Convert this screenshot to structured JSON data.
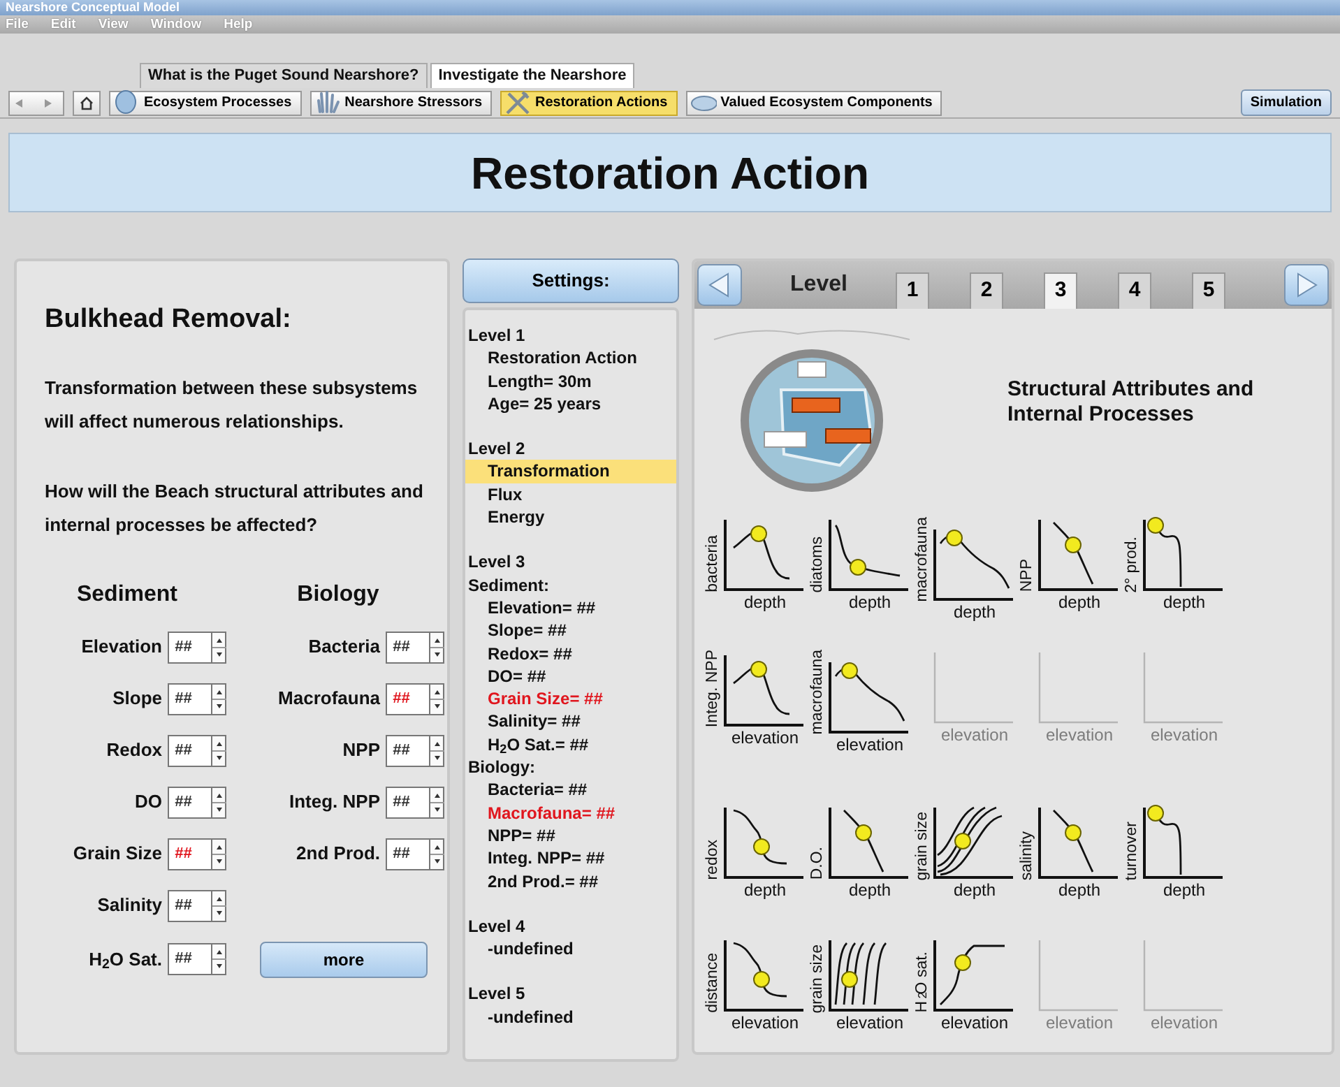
{
  "window": {
    "title": "Nearshore Conceptual Model"
  },
  "menu": [
    "File",
    "Edit",
    "View",
    "Window",
    "Help"
  ],
  "main_tabs": [
    {
      "label": "What is the Puget Sound Nearshore?",
      "selected": false
    },
    {
      "label": "Investigate the Nearshore",
      "selected": true
    }
  ],
  "toolbar": {
    "buttons": [
      {
        "label": "Ecosystem Processes",
        "selected": false
      },
      {
        "label": "Nearshore Stressors",
        "selected": false
      },
      {
        "label": "Restoration Actions",
        "selected": true
      },
      {
        "label": "Valued Ecosystem Components",
        "selected": false
      }
    ],
    "simulation_button": "Simulation"
  },
  "banner": "Restoration Action",
  "action": {
    "title": "Bulkhead Removal:",
    "description": "Transformation between these subsystems will affect numerous relationships.",
    "question": "How will the Beach structural attributes and internal processes be affected?",
    "columns": [
      {
        "heading": "Sediment",
        "fields": [
          {
            "label": "Elevation",
            "value": "##",
            "changed": false
          },
          {
            "label": "Slope",
            "value": "##",
            "changed": false
          },
          {
            "label": "Redox",
            "value": "##",
            "changed": false
          },
          {
            "label": "DO",
            "value": "##",
            "changed": false
          },
          {
            "label": "Grain Size",
            "value": "##",
            "changed": true
          },
          {
            "label": "Salinity",
            "value": "##",
            "changed": false
          },
          {
            "label": "H$_{2}$O Sat.",
            "value": "##",
            "changed": false
          }
        ]
      },
      {
        "heading": "Biology",
        "fields": [
          {
            "label": "Bacteria",
            "value": "##",
            "changed": false
          },
          {
            "label": "Macrofauna",
            "value": "##",
            "changed": true
          },
          {
            "label": "NPP",
            "value": "##",
            "changed": false
          },
          {
            "label": "Integ. NPP",
            "value": "##",
            "changed": false
          },
          {
            "label": "2nd Prod.",
            "value": "##",
            "changed": false
          }
        ]
      }
    ],
    "more_button": "more"
  },
  "settings": {
    "button": "Settings:",
    "groups": [
      {
        "title": "Level 1",
        "entries": [
          {
            "kind": "item",
            "text": "Restoration Action",
            "selected": false,
            "changed": false
          },
          {
            "kind": "item",
            "text": "Length= 30m",
            "selected": false,
            "changed": false
          },
          {
            "kind": "item",
            "text": "Age= 25 years",
            "selected": false,
            "changed": false
          }
        ]
      },
      {
        "title": "Level 2",
        "entries": [
          {
            "kind": "item",
            "text": "Transformation",
            "selected": true,
            "changed": false
          },
          {
            "kind": "item",
            "text": "Flux",
            "selected": false,
            "changed": false
          },
          {
            "kind": "item",
            "text": "Energy",
            "selected": false,
            "changed": false
          }
        ]
      },
      {
        "title": "Level 3",
        "entries": [
          {
            "kind": "subheading",
            "text": "Sediment:",
            "selected": false,
            "changed": false
          },
          {
            "kind": "item",
            "text": "Elevation= ##",
            "selected": false,
            "changed": false
          },
          {
            "kind": "item",
            "text": "Slope= ##",
            "selected": false,
            "changed": false
          },
          {
            "kind": "item",
            "text": "Redox= ##",
            "selected": false,
            "changed": false
          },
          {
            "kind": "item",
            "text": "DO= ##",
            "selected": false,
            "changed": false
          },
          {
            "kind": "item",
            "text": "Grain Size= ##",
            "selected": false,
            "changed": true
          },
          {
            "kind": "item",
            "text": "Salinity= ##",
            "selected": false,
            "changed": false
          },
          {
            "kind": "item",
            "text": "H$_{2}$O Sat.= ##",
            "selected": false,
            "changed": false
          },
          {
            "kind": "subheading",
            "text": "Biology:",
            "selected": false,
            "changed": false
          },
          {
            "kind": "item",
            "text": "Bacteria= ##",
            "selected": false,
            "changed": false
          },
          {
            "kind": "item",
            "text": "Macrofauna= ##",
            "selected": false,
            "changed": true
          },
          {
            "kind": "item",
            "text": "NPP= ##",
            "selected": false,
            "changed": false
          },
          {
            "kind": "item",
            "text": "Integ. NPP= ##",
            "selected": false,
            "changed": false
          },
          {
            "kind": "item",
            "text": "2nd Prod.= ##",
            "selected": false,
            "changed": false
          }
        ]
      },
      {
        "title": "Level 4",
        "entries": [
          {
            "kind": "item",
            "text": "-undefined",
            "selected": false,
            "changed": false
          }
        ]
      },
      {
        "title": "Level 5",
        "entries": [
          {
            "kind": "item",
            "text": "-undefined",
            "selected": false,
            "changed": false
          }
        ]
      }
    ]
  },
  "levels": {
    "label": "Level",
    "tabs": [
      {
        "label": "1",
        "selected": false
      },
      {
        "label": "2",
        "selected": false
      },
      {
        "label": "3",
        "selected": true
      },
      {
        "label": "4",
        "selected": false
      },
      {
        "label": "5",
        "selected": false
      }
    ],
    "heading": "Structural Attributes and Internal Processes",
    "plot_sections": [
      [
        [
          {
            "kind": "hump",
            "ylabel": "bacteria",
            "xlabel": "depth"
          },
          {
            "kind": "decay",
            "ylabel": "diatoms",
            "xlabel": "depth"
          },
          {
            "kind": "peak-decline",
            "ylabel": "macrofauna",
            "xlabel": "depth"
          },
          {
            "kind": "linear-decline",
            "ylabel": "NPP",
            "xlabel": "depth"
          },
          {
            "kind": "step-drop",
            "ylabel": "2° prod.",
            "xlabel": "depth"
          }
        ],
        [
          {
            "kind": "hump",
            "ylabel": "Integ. NPP",
            "xlabel": "elevation"
          },
          {
            "kind": "peak-decline",
            "ylabel": "macrofauna",
            "xlabel": "elevation"
          },
          {
            "kind": "empty",
            "xlabel": "elevation"
          },
          {
            "kind": "empty",
            "xlabel": "elevation"
          },
          {
            "kind": "empty",
            "xlabel": "elevation"
          }
        ]
      ],
      [
        [
          {
            "kind": "stepped-decline",
            "ylabel": "redox",
            "xlabel": "depth"
          },
          {
            "kind": "linear-decline",
            "ylabel": "D.O.",
            "xlabel": "depth"
          },
          {
            "kind": "s-curves",
            "ylabel": "grain size",
            "xlabel": "depth"
          },
          {
            "kind": "linear-decline",
            "ylabel": "salinity",
            "xlabel": "depth"
          },
          {
            "kind": "step-drop",
            "ylabel": "turnover",
            "xlabel": "depth"
          }
        ],
        [
          {
            "kind": "stepped-decline",
            "ylabel": "distance",
            "xlabel": "elevation"
          },
          {
            "kind": "parallel-curves",
            "ylabel": "grain size",
            "xlabel": "elevation"
          },
          {
            "kind": "rise-plateau",
            "ylabel": "H$_{2}$O sat.",
            "xlabel": "elevation"
          },
          {
            "kind": "empty",
            "xlabel": "elevation"
          },
          {
            "kind": "empty",
            "xlabel": "elevation"
          }
        ]
      ]
    ]
  }
}
